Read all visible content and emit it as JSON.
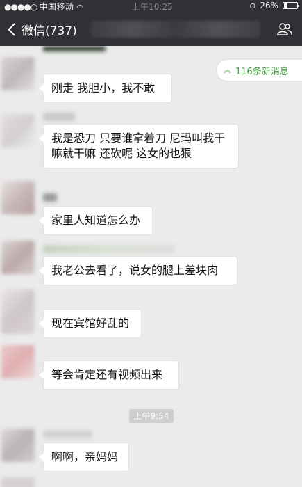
{
  "status_bar": {
    "carrier": "中国移动",
    "time": "上午10:25",
    "battery": "26%",
    "battery_level": 0.26
  },
  "nav": {
    "back_label": "微信(737)"
  },
  "new_messages": "116条新消息",
  "messages": [
    {
      "text": "刚走  我胆小，我不敢"
    },
    {
      "text": "我是恐刀   只要谁拿着刀   尼玛叫我干嘛就干嘛   还砍呢     这女的也狠"
    },
    {
      "text": "家里人知道怎么办"
    },
    {
      "text": "我老公去看了，说女的腿上差块肉"
    },
    {
      "text": "现在宾馆好乱的"
    },
    {
      "text": "等会肯定还有视频出来"
    },
    {
      "text": "啊啊，亲妈妈"
    }
  ],
  "timestamp": "上午9:54",
  "colors": {
    "nav_bg": "#2f3134",
    "chat_bg": "#ebebeb",
    "accent_green": "#3fa33a"
  }
}
